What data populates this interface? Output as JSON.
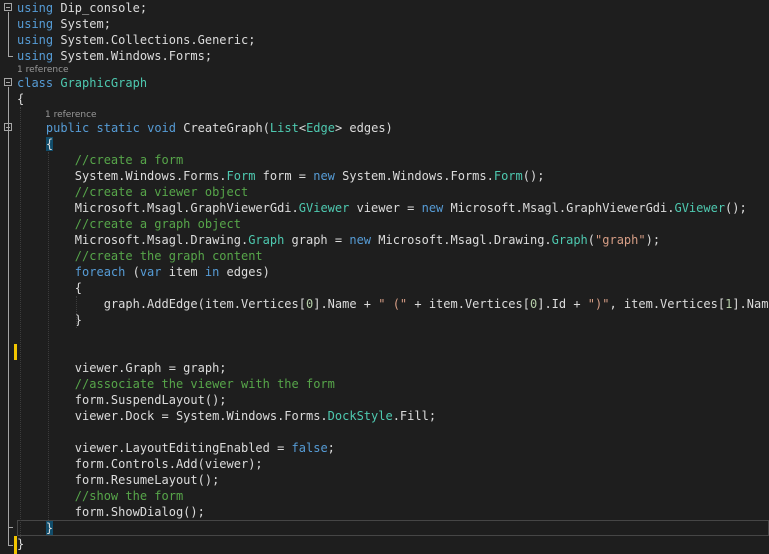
{
  "editor": {
    "colors": {
      "background": "#1e1e1e",
      "keyword": "#569cd6",
      "type": "#4ec9b0",
      "string": "#d69d85",
      "comment": "#57a64a",
      "number": "#b5cea8",
      "plain": "#dcdcdc",
      "codelens": "#999999",
      "change_marker": "#f2c500"
    },
    "codelens": {
      "class_refs": "1 reference",
      "method_refs": "1 reference"
    },
    "lines": [
      [
        {
          "t": "using",
          "k": "kw"
        },
        {
          "t": " Dip_console;"
        }
      ],
      [
        {
          "t": "using",
          "k": "kw"
        },
        {
          "t": " System;"
        }
      ],
      [
        {
          "t": "using",
          "k": "kw"
        },
        {
          "t": " System.Collections.Generic;"
        }
      ],
      [
        {
          "t": "using",
          "k": "kw"
        },
        {
          "t": " System.Windows.Forms;"
        }
      ],
      [
        {
          "t": "class",
          "k": "kw"
        },
        {
          "t": " "
        },
        {
          "t": "GraphicGraph",
          "k": "type"
        }
      ],
      [
        {
          "t": "{"
        }
      ],
      [
        {
          "t": "    "
        },
        {
          "t": "public",
          "k": "kw"
        },
        {
          "t": " "
        },
        {
          "t": "static",
          "k": "kw"
        },
        {
          "t": " "
        },
        {
          "t": "void",
          "k": "kw"
        },
        {
          "t": " CreateGraph("
        },
        {
          "t": "List",
          "k": "type"
        },
        {
          "t": "<"
        },
        {
          "t": "Edge",
          "k": "type"
        },
        {
          "t": "> edges)"
        }
      ],
      [
        {
          "t": "    "
        },
        {
          "t": "{",
          "k": "brace"
        }
      ],
      [
        {
          "t": "        "
        },
        {
          "t": "//create a form",
          "k": "cmt"
        }
      ],
      [
        {
          "t": "        System.Windows.Forms."
        },
        {
          "t": "Form",
          "k": "type"
        },
        {
          "t": " form = "
        },
        {
          "t": "new",
          "k": "kw"
        },
        {
          "t": " System.Windows.Forms."
        },
        {
          "t": "Form",
          "k": "type"
        },
        {
          "t": "();"
        }
      ],
      [
        {
          "t": "        "
        },
        {
          "t": "//create a viewer object",
          "k": "cmt"
        }
      ],
      [
        {
          "t": "        Microsoft.Msagl.GraphViewerGdi."
        },
        {
          "t": "GViewer",
          "k": "type"
        },
        {
          "t": " viewer = "
        },
        {
          "t": "new",
          "k": "kw"
        },
        {
          "t": " Microsoft.Msagl.GraphViewerGdi."
        },
        {
          "t": "GViewer",
          "k": "type"
        },
        {
          "t": "();"
        }
      ],
      [
        {
          "t": "        "
        },
        {
          "t": "//create a graph object",
          "k": "cmt"
        }
      ],
      [
        {
          "t": "        Microsoft.Msagl.Drawing."
        },
        {
          "t": "Graph",
          "k": "type"
        },
        {
          "t": " graph = "
        },
        {
          "t": "new",
          "k": "kw"
        },
        {
          "t": " Microsoft.Msagl.Drawing."
        },
        {
          "t": "Graph",
          "k": "type"
        },
        {
          "t": "("
        },
        {
          "t": "\"graph\"",
          "k": "str"
        },
        {
          "t": ");"
        }
      ],
      [
        {
          "t": "        "
        },
        {
          "t": "//create the graph content",
          "k": "cmt"
        }
      ],
      [
        {
          "t": "        "
        },
        {
          "t": "foreach",
          "k": "kw"
        },
        {
          "t": " ("
        },
        {
          "t": "var",
          "k": "kw"
        },
        {
          "t": " item "
        },
        {
          "t": "in",
          "k": "kw"
        },
        {
          "t": " edges)"
        }
      ],
      [
        {
          "t": "        {"
        }
      ],
      [
        {
          "t": "            graph.AddEdge(item.Vertices["
        },
        {
          "t": "0",
          "k": "num"
        },
        {
          "t": "].Name + "
        },
        {
          "t": "\" (\"",
          "k": "str"
        },
        {
          "t": " + item.Vertices["
        },
        {
          "t": "0",
          "k": "num"
        },
        {
          "t": "].Id + "
        },
        {
          "t": "\")\"",
          "k": "str"
        },
        {
          "t": ", item.Vertices["
        },
        {
          "t": "1",
          "k": "num"
        },
        {
          "t": "].Name +"
        }
      ],
      [
        {
          "t": "        }"
        }
      ],
      [],
      [],
      [
        {
          "t": "        viewer.Graph = graph;"
        }
      ],
      [
        {
          "t": "        "
        },
        {
          "t": "//associate the viewer with the form",
          "k": "cmt"
        }
      ],
      [
        {
          "t": "        form.SuspendLayout();"
        }
      ],
      [
        {
          "t": "        viewer.Dock = System.Windows.Forms."
        },
        {
          "t": "DockStyle",
          "k": "type"
        },
        {
          "t": ".Fill;"
        }
      ],
      [],
      [
        {
          "t": "        viewer.LayoutEditingEnabled = "
        },
        {
          "t": "false",
          "k": "kw"
        },
        {
          "t": ";"
        }
      ],
      [
        {
          "t": "        form.Controls.Add(viewer);"
        }
      ],
      [
        {
          "t": "        form.ResumeLayout();"
        }
      ],
      [
        {
          "t": "        "
        },
        {
          "t": "//show the form",
          "k": "cmt"
        }
      ],
      [
        {
          "t": "        form.ShowDialog();"
        }
      ],
      [
        {
          "t": "    "
        },
        {
          "t": "}",
          "k": "brace"
        }
      ],
      [
        {
          "t": "}"
        }
      ]
    ]
  }
}
